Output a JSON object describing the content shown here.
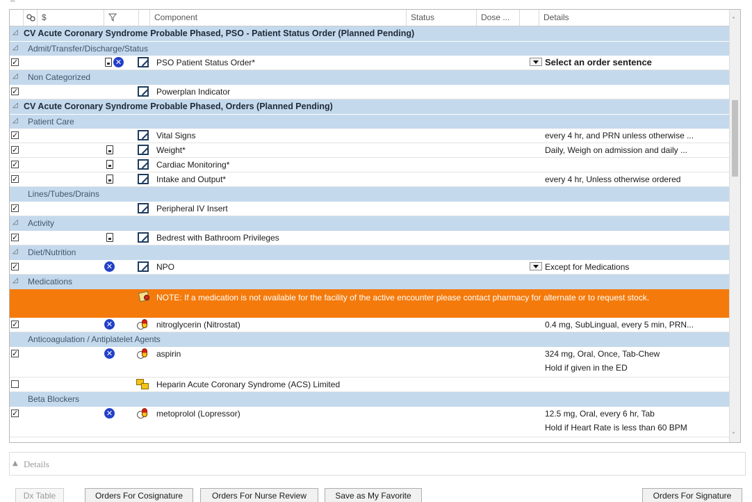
{
  "header": {
    "col_component": "Component",
    "col_status": "Status",
    "col_dose": "Dose ...",
    "col_details": "Details",
    "col_dollar": "$"
  },
  "rows": [
    {
      "type": "phase",
      "label": "CV Acute Coronary Syndrome Probable Phased, PSO - Patient Status Order (Planned Pending)"
    },
    {
      "type": "category",
      "label": "Admit/Transfer/Discharge/Status"
    },
    {
      "type": "order",
      "checked": true,
      "doc": true,
      "x": true,
      "icon": "order",
      "component": "PSO Patient Status Order*",
      "dropdown": true,
      "details": "Select an order sentence",
      "details_bold": true
    },
    {
      "type": "category",
      "label": "Non Categorized"
    },
    {
      "type": "order",
      "checked": true,
      "icon": "order",
      "component": "Powerplan Indicator",
      "sep": true
    },
    {
      "type": "phase",
      "label": "CV Acute Coronary Syndrome Probable Phased, Orders (Planned Pending)"
    },
    {
      "type": "category",
      "label": "Patient Care"
    },
    {
      "type": "order",
      "checked": true,
      "icon": "order",
      "component": "Vital Signs",
      "details": "every 4 hr, and PRN unless otherwise ..."
    },
    {
      "type": "order",
      "checked": true,
      "doc": true,
      "icon": "order",
      "component": "Weight*",
      "details": "Daily, Weigh on admission and daily ..."
    },
    {
      "type": "order",
      "checked": true,
      "doc": true,
      "icon": "order",
      "component": "Cardiac Monitoring*"
    },
    {
      "type": "order",
      "checked": true,
      "doc": true,
      "icon": "order",
      "component": "Intake and Output*",
      "details": "every 4 hr, Unless otherwise ordered"
    },
    {
      "type": "category",
      "label": "Lines/Tubes/Drains",
      "noarrow": true
    },
    {
      "type": "order",
      "checked": true,
      "icon": "order",
      "component": "Peripheral IV Insert"
    },
    {
      "type": "category",
      "label": "Activity"
    },
    {
      "type": "order",
      "checked": true,
      "doc": true,
      "icon": "order",
      "component": "Bedrest with Bathroom Privileges"
    },
    {
      "type": "category",
      "label": "Diet/Nutrition"
    },
    {
      "type": "order",
      "checked": true,
      "x": true,
      "icon": "order",
      "component": "NPO",
      "dropdown": true,
      "details": "Except for Medications"
    },
    {
      "type": "category",
      "label": "Medications"
    },
    {
      "type": "note",
      "text": "NOTE: If a medication is not available for the facility of the active encounter please contact pharmacy for alternate or to request stock."
    },
    {
      "type": "order",
      "checked": true,
      "x": true,
      "icon": "med",
      "component": "nitroglycerin (Nitrostat)",
      "details": "0.4 mg, SubLingual, every 5 min, PRN..."
    },
    {
      "type": "category",
      "label": "Anticoagulation / Antiplatelet Agents",
      "noarrow": true
    },
    {
      "type": "order",
      "checked": true,
      "x": true,
      "icon": "med",
      "component": "aspirin",
      "details": "324 mg, Oral, Once, Tab-Chew",
      "details2": "Hold if given in the ED",
      "two": true
    },
    {
      "type": "order",
      "checked": false,
      "icon": "plan",
      "component": "Heparin Acute Coronary Syndrome (ACS) Limited"
    },
    {
      "type": "category",
      "label": "Beta Blockers",
      "noarrow": true
    },
    {
      "type": "order",
      "checked": true,
      "x": true,
      "icon": "med",
      "component": "metoprolol (Lopressor)",
      "details": "12.5 mg, Oral, every 6 hr, Tab",
      "details2": "Hold if Heart Rate is less than 60 BPM",
      "two": true
    }
  ],
  "details_panel": {
    "label": "Details"
  },
  "buttons": {
    "dx_table": "Dx Table",
    "cosign": "Orders For Cosignature",
    "nurse_review": "Orders For Nurse Review",
    "favorite": "Save as My Favorite",
    "signature": "Orders For Signature"
  }
}
